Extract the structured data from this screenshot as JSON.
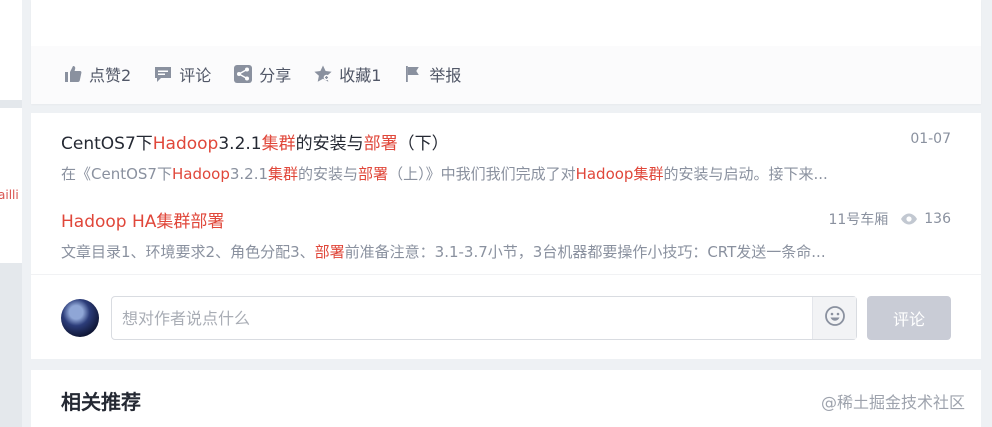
{
  "left_fragment": "ailli",
  "actions": [
    {
      "icon": "thumbs-up-icon",
      "label": "点赞2"
    },
    {
      "icon": "comment-icon",
      "label": "评论"
    },
    {
      "icon": "share-icon",
      "label": "分享"
    },
    {
      "icon": "star-icon",
      "label": "收藏1"
    },
    {
      "icon": "flag-icon",
      "label": "举报"
    }
  ],
  "related": [
    {
      "title_parts": [
        "CentOS7下",
        "Hadoop",
        "3.2.1",
        "集群",
        "的安装与",
        "部署",
        "（下）"
      ],
      "date": "01-07",
      "desc_parts": [
        "在《CentOS7下",
        "Hadoop",
        "3.2.1",
        "集群",
        "的安装与",
        "部署",
        "（上）》中我们我们完成了对",
        "Hadoop集群",
        "的安装与启动。接下来..."
      ]
    },
    {
      "title": "Hadoop HA集群部署",
      "author": "11号车厢",
      "views": "136",
      "desc_parts": [
        "文章目录1、环境要求2、角色分配3、",
        "部署",
        "前准备注意：3.1-3.7小节，3台机器都要操作小技巧：CRT发送一条命..."
      ]
    }
  ],
  "comment": {
    "placeholder": "想对作者说点什么",
    "submit_label": "评论"
  },
  "recommend_title": "相关推荐",
  "watermark": "@稀土掘金技术社区",
  "colors": {
    "highlight": "#e0473a",
    "text": "#252933",
    "muted": "#8a919f"
  }
}
